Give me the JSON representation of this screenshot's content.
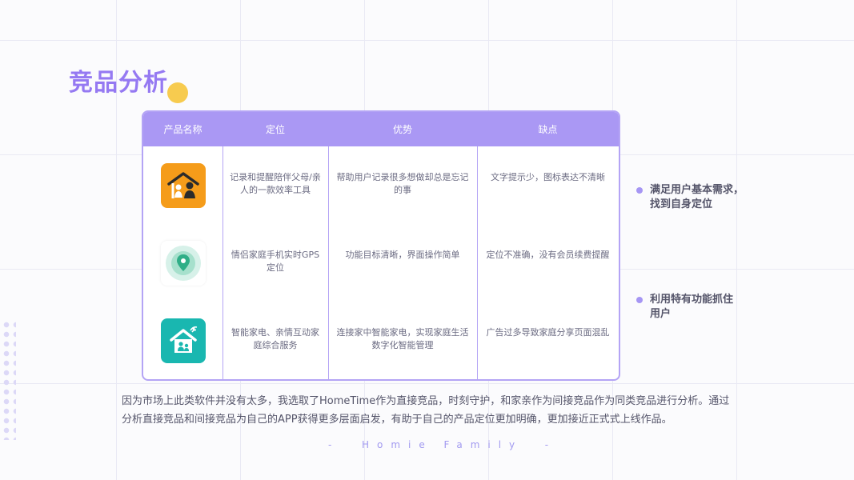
{
  "title": "竞品分析",
  "table": {
    "headers": [
      "产品名称",
      "定位",
      "优势",
      "缺点"
    ],
    "rows": [
      {
        "icon": "home-family-app-icon",
        "position": "记录和提醒陪伴父母/亲人的一款效率工具",
        "advantage": "帮助用户记录很多想做却总是忘记的事",
        "disadvantage": "文字提示少，图标表达不清晰"
      },
      {
        "icon": "location-pin-app-icon",
        "position": "情侣家庭手机实时GPS定位",
        "advantage": "功能目标清晰，界面操作简单",
        "disadvantage": "定位不准确，没有会员续费提醒"
      },
      {
        "icon": "smart-home-app-icon",
        "position": "智能家电、亲情互动家庭综合服务",
        "advantage": "连接家中智能家电，实现家庭生活数字化智能管理",
        "disadvantage": "广告过多导致家庭分享页面混乱"
      }
    ]
  },
  "bullets": [
    {
      "line1": "满足用户基本需求，",
      "line2": "找到自身定位"
    },
    {
      "line1": "利用特有功能抓住",
      "line2": "用户"
    }
  ],
  "paragraph": "因为市场上此类软件并没有太多，我选取了HomeTime作为直接竞品，时刻守护，和家亲作为间接竞品作为同类竞品进行分析。通过分析直接竞品和间接竞品为自己的APP获得更多层面启发，有助于自己的产品定位更加明确，更加接近正式式上线作品。",
  "footer": "-  Homie Family  -",
  "colors": {
    "accent": "#9579f2",
    "header": "#aa98f4",
    "dot": "#f7cb4f"
  }
}
